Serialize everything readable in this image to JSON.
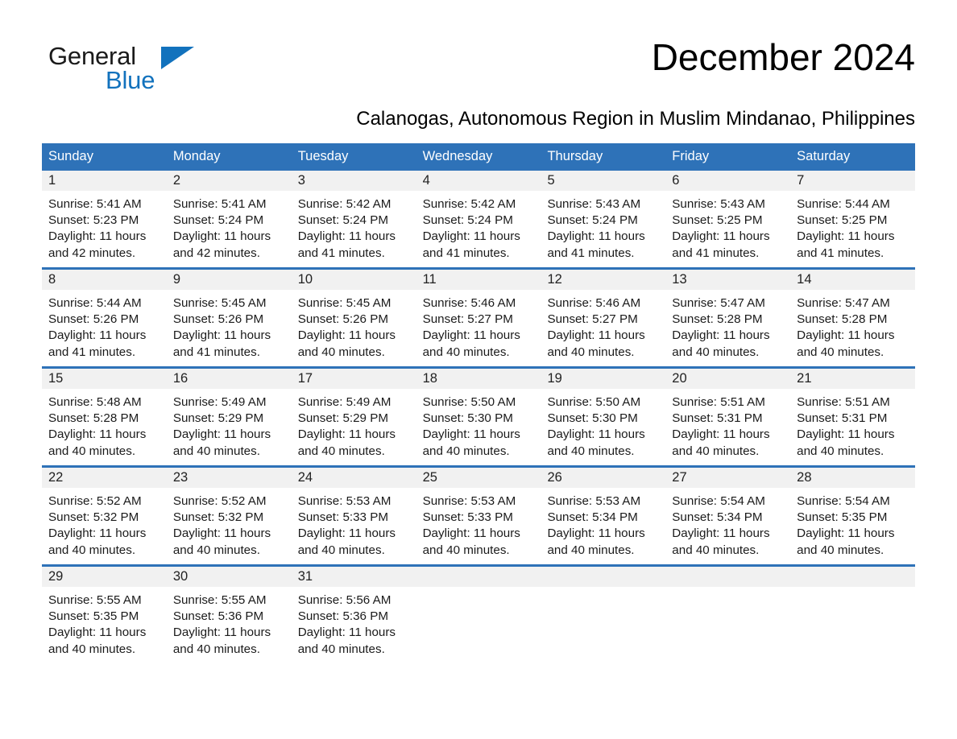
{
  "brand": {
    "name_top": "General",
    "name_bottom": "Blue",
    "accent_color": "#1272bd"
  },
  "header": {
    "title": "December 2024",
    "subtitle": "Calanogas, Autonomous Region in Muslim Mindanao, Philippines"
  },
  "theme": {
    "header_blue": "#2e72b8",
    "day_band_gray": "#f1f1f1",
    "page_background": "#ffffff"
  },
  "calendar": {
    "weekdays": [
      "Sunday",
      "Monday",
      "Tuesday",
      "Wednesday",
      "Thursday",
      "Friday",
      "Saturday"
    ],
    "weeks": [
      [
        {
          "day": "1",
          "sunrise": "Sunrise: 5:41 AM",
          "sunset": "Sunset: 5:23 PM",
          "daylight_line1": "Daylight: 11 hours",
          "daylight_line2": "and 42 minutes."
        },
        {
          "day": "2",
          "sunrise": "Sunrise: 5:41 AM",
          "sunset": "Sunset: 5:24 PM",
          "daylight_line1": "Daylight: 11 hours",
          "daylight_line2": "and 42 minutes."
        },
        {
          "day": "3",
          "sunrise": "Sunrise: 5:42 AM",
          "sunset": "Sunset: 5:24 PM",
          "daylight_line1": "Daylight: 11 hours",
          "daylight_line2": "and 41 minutes."
        },
        {
          "day": "4",
          "sunrise": "Sunrise: 5:42 AM",
          "sunset": "Sunset: 5:24 PM",
          "daylight_line1": "Daylight: 11 hours",
          "daylight_line2": "and 41 minutes."
        },
        {
          "day": "5",
          "sunrise": "Sunrise: 5:43 AM",
          "sunset": "Sunset: 5:24 PM",
          "daylight_line1": "Daylight: 11 hours",
          "daylight_line2": "and 41 minutes."
        },
        {
          "day": "6",
          "sunrise": "Sunrise: 5:43 AM",
          "sunset": "Sunset: 5:25 PM",
          "daylight_line1": "Daylight: 11 hours",
          "daylight_line2": "and 41 minutes."
        },
        {
          "day": "7",
          "sunrise": "Sunrise: 5:44 AM",
          "sunset": "Sunset: 5:25 PM",
          "daylight_line1": "Daylight: 11 hours",
          "daylight_line2": "and 41 minutes."
        }
      ],
      [
        {
          "day": "8",
          "sunrise": "Sunrise: 5:44 AM",
          "sunset": "Sunset: 5:26 PM",
          "daylight_line1": "Daylight: 11 hours",
          "daylight_line2": "and 41 minutes."
        },
        {
          "day": "9",
          "sunrise": "Sunrise: 5:45 AM",
          "sunset": "Sunset: 5:26 PM",
          "daylight_line1": "Daylight: 11 hours",
          "daylight_line2": "and 41 minutes."
        },
        {
          "day": "10",
          "sunrise": "Sunrise: 5:45 AM",
          "sunset": "Sunset: 5:26 PM",
          "daylight_line1": "Daylight: 11 hours",
          "daylight_line2": "and 40 minutes."
        },
        {
          "day": "11",
          "sunrise": "Sunrise: 5:46 AM",
          "sunset": "Sunset: 5:27 PM",
          "daylight_line1": "Daylight: 11 hours",
          "daylight_line2": "and 40 minutes."
        },
        {
          "day": "12",
          "sunrise": "Sunrise: 5:46 AM",
          "sunset": "Sunset: 5:27 PM",
          "daylight_line1": "Daylight: 11 hours",
          "daylight_line2": "and 40 minutes."
        },
        {
          "day": "13",
          "sunrise": "Sunrise: 5:47 AM",
          "sunset": "Sunset: 5:28 PM",
          "daylight_line1": "Daylight: 11 hours",
          "daylight_line2": "and 40 minutes."
        },
        {
          "day": "14",
          "sunrise": "Sunrise: 5:47 AM",
          "sunset": "Sunset: 5:28 PM",
          "daylight_line1": "Daylight: 11 hours",
          "daylight_line2": "and 40 minutes."
        }
      ],
      [
        {
          "day": "15",
          "sunrise": "Sunrise: 5:48 AM",
          "sunset": "Sunset: 5:28 PM",
          "daylight_line1": "Daylight: 11 hours",
          "daylight_line2": "and 40 minutes."
        },
        {
          "day": "16",
          "sunrise": "Sunrise: 5:49 AM",
          "sunset": "Sunset: 5:29 PM",
          "daylight_line1": "Daylight: 11 hours",
          "daylight_line2": "and 40 minutes."
        },
        {
          "day": "17",
          "sunrise": "Sunrise: 5:49 AM",
          "sunset": "Sunset: 5:29 PM",
          "daylight_line1": "Daylight: 11 hours",
          "daylight_line2": "and 40 minutes."
        },
        {
          "day": "18",
          "sunrise": "Sunrise: 5:50 AM",
          "sunset": "Sunset: 5:30 PM",
          "daylight_line1": "Daylight: 11 hours",
          "daylight_line2": "and 40 minutes."
        },
        {
          "day": "19",
          "sunrise": "Sunrise: 5:50 AM",
          "sunset": "Sunset: 5:30 PM",
          "daylight_line1": "Daylight: 11 hours",
          "daylight_line2": "and 40 minutes."
        },
        {
          "day": "20",
          "sunrise": "Sunrise: 5:51 AM",
          "sunset": "Sunset: 5:31 PM",
          "daylight_line1": "Daylight: 11 hours",
          "daylight_line2": "and 40 minutes."
        },
        {
          "day": "21",
          "sunrise": "Sunrise: 5:51 AM",
          "sunset": "Sunset: 5:31 PM",
          "daylight_line1": "Daylight: 11 hours",
          "daylight_line2": "and 40 minutes."
        }
      ],
      [
        {
          "day": "22",
          "sunrise": "Sunrise: 5:52 AM",
          "sunset": "Sunset: 5:32 PM",
          "daylight_line1": "Daylight: 11 hours",
          "daylight_line2": "and 40 minutes."
        },
        {
          "day": "23",
          "sunrise": "Sunrise: 5:52 AM",
          "sunset": "Sunset: 5:32 PM",
          "daylight_line1": "Daylight: 11 hours",
          "daylight_line2": "and 40 minutes."
        },
        {
          "day": "24",
          "sunrise": "Sunrise: 5:53 AM",
          "sunset": "Sunset: 5:33 PM",
          "daylight_line1": "Daylight: 11 hours",
          "daylight_line2": "and 40 minutes."
        },
        {
          "day": "25",
          "sunrise": "Sunrise: 5:53 AM",
          "sunset": "Sunset: 5:33 PM",
          "daylight_line1": "Daylight: 11 hours",
          "daylight_line2": "and 40 minutes."
        },
        {
          "day": "26",
          "sunrise": "Sunrise: 5:53 AM",
          "sunset": "Sunset: 5:34 PM",
          "daylight_line1": "Daylight: 11 hours",
          "daylight_line2": "and 40 minutes."
        },
        {
          "day": "27",
          "sunrise": "Sunrise: 5:54 AM",
          "sunset": "Sunset: 5:34 PM",
          "daylight_line1": "Daylight: 11 hours",
          "daylight_line2": "and 40 minutes."
        },
        {
          "day": "28",
          "sunrise": "Sunrise: 5:54 AM",
          "sunset": "Sunset: 5:35 PM",
          "daylight_line1": "Daylight: 11 hours",
          "daylight_line2": "and 40 minutes."
        }
      ],
      [
        {
          "day": "29",
          "sunrise": "Sunrise: 5:55 AM",
          "sunset": "Sunset: 5:35 PM",
          "daylight_line1": "Daylight: 11 hours",
          "daylight_line2": "and 40 minutes."
        },
        {
          "day": "30",
          "sunrise": "Sunrise: 5:55 AM",
          "sunset": "Sunset: 5:36 PM",
          "daylight_line1": "Daylight: 11 hours",
          "daylight_line2": "and 40 minutes."
        },
        {
          "day": "31",
          "sunrise": "Sunrise: 5:56 AM",
          "sunset": "Sunset: 5:36 PM",
          "daylight_line1": "Daylight: 11 hours",
          "daylight_line2": "and 40 minutes."
        },
        {
          "day": "",
          "sunrise": "",
          "sunset": "",
          "daylight_line1": "",
          "daylight_line2": ""
        },
        {
          "day": "",
          "sunrise": "",
          "sunset": "",
          "daylight_line1": "",
          "daylight_line2": ""
        },
        {
          "day": "",
          "sunrise": "",
          "sunset": "",
          "daylight_line1": "",
          "daylight_line2": ""
        },
        {
          "day": "",
          "sunrise": "",
          "sunset": "",
          "daylight_line1": "",
          "daylight_line2": ""
        }
      ]
    ]
  }
}
